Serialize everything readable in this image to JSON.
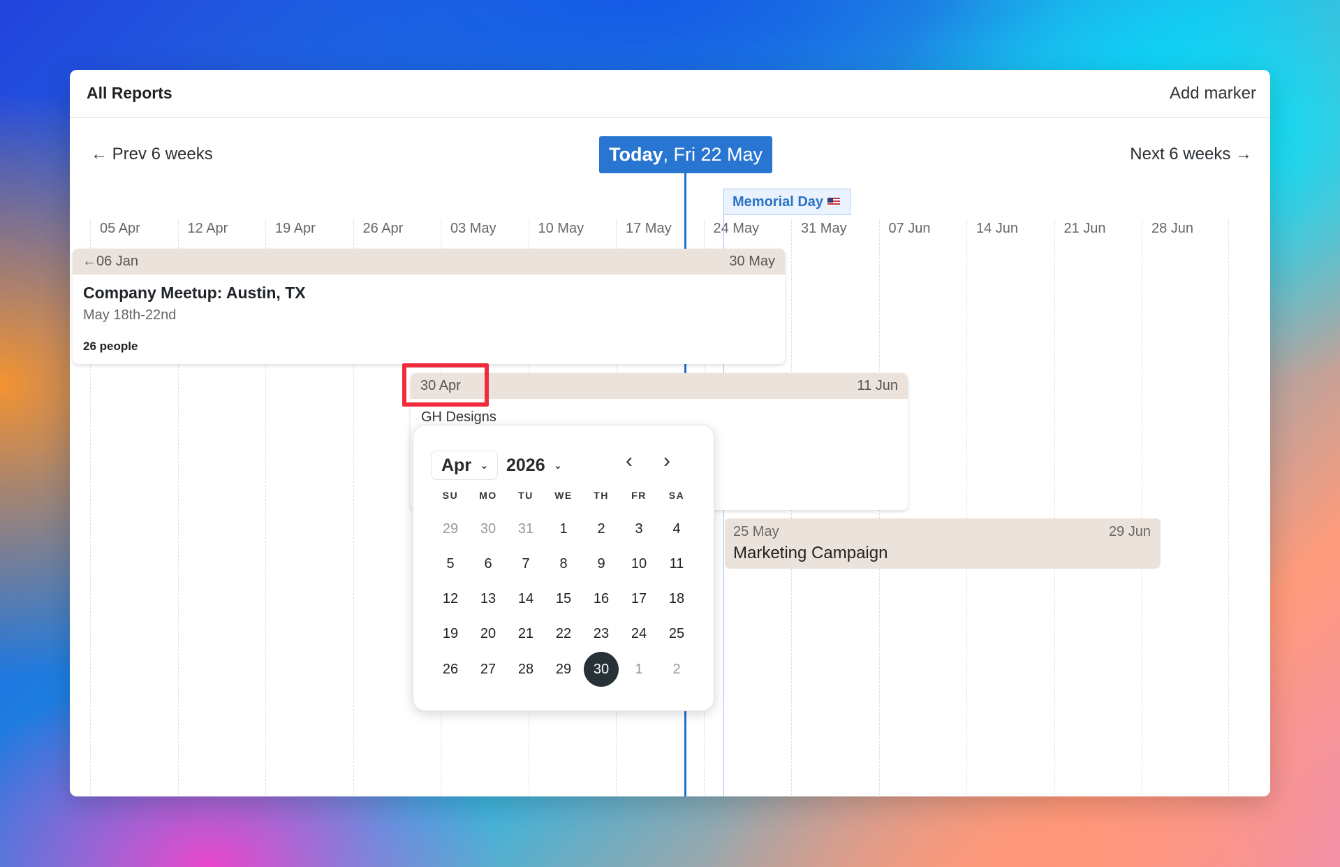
{
  "header": {
    "title": "All Reports",
    "add_marker": "Add marker"
  },
  "nav": {
    "prev": "← Prev 6 weeks",
    "next": "Next 6 weeks →",
    "today_strong": "Today",
    "today_rest": ", Fri 22 May"
  },
  "weeks": [
    "05 Apr",
    "12 Apr",
    "19 Apr",
    "26 Apr",
    "03 May",
    "10 May",
    "17 May",
    "24 May",
    "31 May",
    "07 Jun",
    "14 Jun",
    "21 Jun",
    "28 Jun"
  ],
  "marker": {
    "label": "Memorial Day"
  },
  "events": [
    {
      "start": "←06 Jan",
      "end": "30 May",
      "name": "Company Meetup: Austin, TX",
      "dates": "May 18th-22nd",
      "people": "26 people"
    },
    {
      "start": "30 Apr",
      "end": "11 Jun",
      "name": "GH Designs"
    },
    {
      "start": "25 May",
      "end": "29 Jun",
      "name": "Marketing Campaign"
    }
  ],
  "datepicker": {
    "month": "Apr",
    "year": "2026",
    "weekdays": [
      "SU",
      "MO",
      "TU",
      "WE",
      "TH",
      "FR",
      "SA"
    ],
    "weeks": [
      [
        {
          "d": "29",
          "m": true
        },
        {
          "d": "30",
          "m": true
        },
        {
          "d": "31",
          "m": true
        },
        {
          "d": "1"
        },
        {
          "d": "2"
        },
        {
          "d": "3"
        },
        {
          "d": "4"
        }
      ],
      [
        {
          "d": "5"
        },
        {
          "d": "6"
        },
        {
          "d": "7"
        },
        {
          "d": "8"
        },
        {
          "d": "9"
        },
        {
          "d": "10"
        },
        {
          "d": "11"
        }
      ],
      [
        {
          "d": "12"
        },
        {
          "d": "13"
        },
        {
          "d": "14"
        },
        {
          "d": "15"
        },
        {
          "d": "16"
        },
        {
          "d": "17"
        },
        {
          "d": "18"
        }
      ],
      [
        {
          "d": "19"
        },
        {
          "d": "20"
        },
        {
          "d": "21"
        },
        {
          "d": "22"
        },
        {
          "d": "23"
        },
        {
          "d": "24"
        },
        {
          "d": "25"
        }
      ],
      [
        {
          "d": "26"
        },
        {
          "d": "27"
        },
        {
          "d": "28"
        },
        {
          "d": "29"
        },
        {
          "d": "30",
          "s": true
        },
        {
          "d": "1",
          "m": true
        },
        {
          "d": "2",
          "m": true
        }
      ]
    ]
  },
  "colors": {
    "accent": "#2976d2",
    "highlight": "#ef2c3d",
    "event_header": "#ebe3db",
    "selected_day": "#263238"
  }
}
